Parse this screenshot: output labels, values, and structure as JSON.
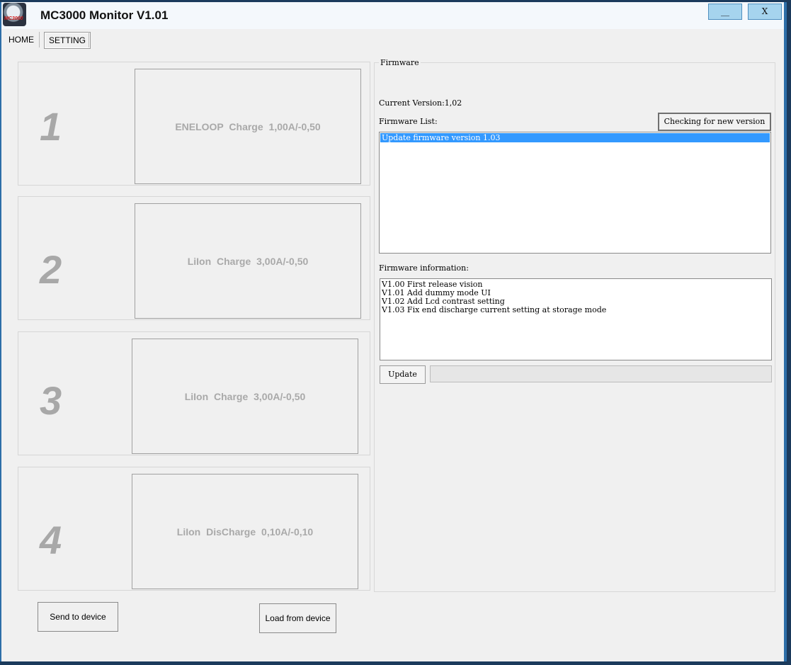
{
  "window": {
    "title": "MC3000 Monitor V1.01",
    "logo_text": "MC3000",
    "minimize_label": "__",
    "close_label": "X"
  },
  "tabs": [
    {
      "label": "HOME",
      "active": false
    },
    {
      "label": "SETTING",
      "active": true
    }
  ],
  "slots": [
    {
      "number": "1",
      "mode": "ENELOOP  Charge  1,00A/-0,50"
    },
    {
      "number": "2",
      "mode": "LiIon  Charge  3,00A/-0,50"
    },
    {
      "number": "3",
      "mode": "LiIon  Charge  3,00A/-0,50"
    },
    {
      "number": "4",
      "mode": "LiIon  DisCharge  0,10A/-0,10"
    }
  ],
  "firmware": {
    "group_label": "Firmware",
    "current_version": "Current Version:1,02",
    "list_label": "Firmware List:",
    "check_button": "Checking for new version",
    "list_items": [
      "Update firmware version 1.03"
    ],
    "info_label": "Firmware information:",
    "info_lines": [
      "V1.00 First release vision",
      "V1.01 Add dummy mode UI",
      "V1.02 Add Lcd contrast setting",
      "V1.03 Fix end discharge current setting at storage mode"
    ],
    "update_button": "Update",
    "progress": 0
  },
  "actions": {
    "send_button": "Send to device",
    "load_button": "Load from device"
  },
  "colors": {
    "selection": "#3399ff",
    "titlebar_buttons": "#a6d4ee",
    "slot_text": "#a9a9a9"
  }
}
